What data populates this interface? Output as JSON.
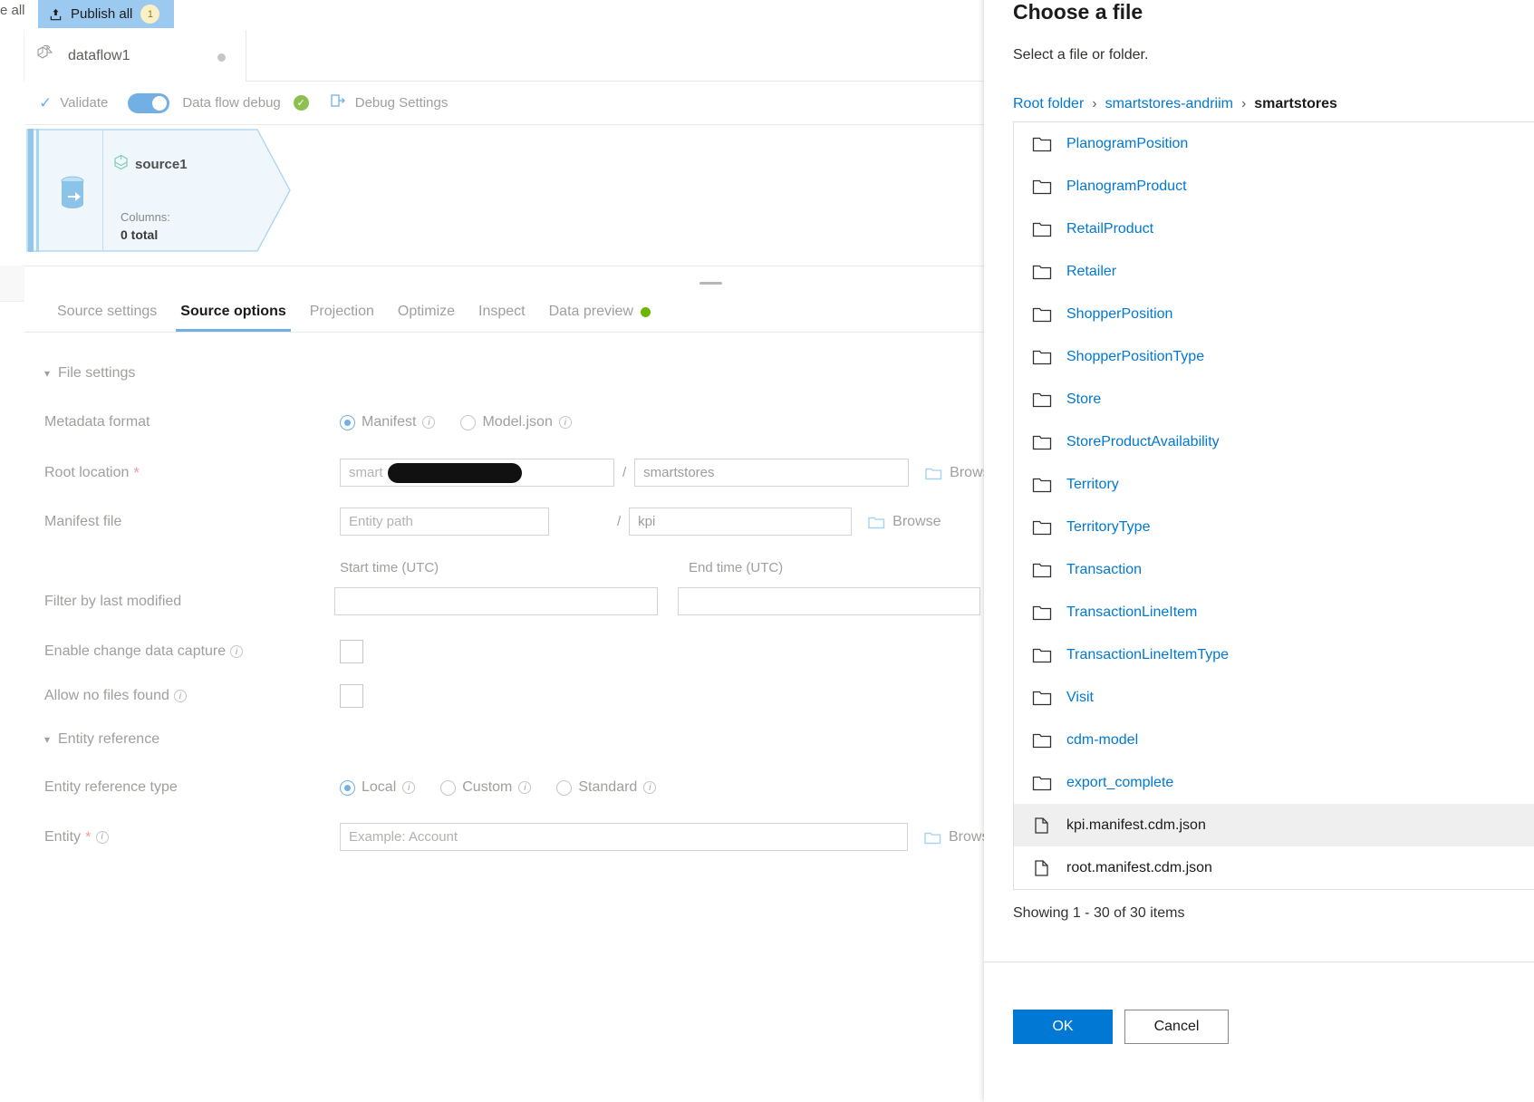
{
  "colors": {
    "accent": "#0078d4",
    "link": "#0078d4",
    "publish_bar": "#9cc9ef",
    "toggle_on": "#71afe5",
    "status_green": "#6bb700",
    "debug_ok": "#8cc152",
    "required_star": "#e8a0a0",
    "node_fill": "#eff6fc",
    "node_stroke": "#a7d3f0"
  },
  "topbar": {
    "left_partial_label": "e all",
    "publish_all_label": "Publish all",
    "publish_all_badge": "1",
    "publish_icon": "upload-icon"
  },
  "dataflow_tab": {
    "name": "dataflow1",
    "icon": "dataflow-icon",
    "modified_dot": "unsaved-dot"
  },
  "toolbar": {
    "validate_label": "Validate",
    "validate_icon": "checkmark-icon",
    "debug_toggle_label": "Data flow debug",
    "debug_toggle_on": true,
    "debug_status_icon": "check-circle-icon",
    "debug_settings_label": "Debug Settings",
    "debug_settings_icon": "debug-settings-icon"
  },
  "canvas": {
    "node": {
      "title": "source1",
      "title_icon": "source-database-icon",
      "side_icon": "source-stream-icon",
      "columns_label": "Columns:",
      "columns_value": "0 total"
    },
    "add_icon": "plus-icon"
  },
  "tabs": [
    {
      "label": "Source settings",
      "active": false,
      "name": "tab-source-settings"
    },
    {
      "label": "Source options",
      "active": true,
      "name": "tab-source-options"
    },
    {
      "label": "Projection",
      "active": false,
      "name": "tab-projection"
    },
    {
      "label": "Optimize",
      "active": false,
      "name": "tab-optimize"
    },
    {
      "label": "Inspect",
      "active": false,
      "name": "tab-inspect"
    },
    {
      "label": "Data preview",
      "active": false,
      "name": "tab-data-preview",
      "status_dot": true
    }
  ],
  "form": {
    "file_settings_header": "File settings",
    "metadata_format": {
      "label": "Metadata format",
      "options": [
        {
          "label": "Manifest",
          "selected": true
        },
        {
          "label": "Model.json",
          "selected": false
        }
      ]
    },
    "root_location": {
      "label": "Root location",
      "required": true,
      "container_value": "smart",
      "container_redacted": true,
      "separator": "/",
      "folder_value": "smartstores",
      "browse_label": "Browse"
    },
    "manifest_file": {
      "label": "Manifest file",
      "entity_placeholder": "Entity path",
      "separator": "/",
      "manifest_value": "kpi",
      "browse_label": "Browse"
    },
    "filter_by_last_modified": {
      "label": "Filter by last modified",
      "start_col_header": "Start time (UTC)",
      "end_col_header": "End time (UTC)",
      "start_value": "",
      "end_value": ""
    },
    "enable_change_data_capture": {
      "label": "Enable change data capture",
      "checked": false
    },
    "allow_no_files_found": {
      "label": "Allow no files found",
      "checked": false
    },
    "entity_reference_header": "Entity reference",
    "entity_reference_type": {
      "label": "Entity reference type",
      "options": [
        {
          "label": "Local",
          "selected": true
        },
        {
          "label": "Custom",
          "selected": false
        },
        {
          "label": "Standard",
          "selected": false
        }
      ]
    },
    "entity": {
      "label": "Entity",
      "required": true,
      "placeholder": "Example: Account",
      "browse_label": "Browse"
    }
  },
  "dialog": {
    "title": "Choose a file",
    "subtitle": "Select a file or folder.",
    "breadcrumb": [
      {
        "label": "Root folder",
        "current": false
      },
      {
        "label": "smartstores-andriim",
        "current": false
      },
      {
        "label": "smartstores",
        "current": true
      }
    ],
    "breadcrumb_separator": "›",
    "items": [
      {
        "name": "PlanogramPosition",
        "type": "folder",
        "selected": false
      },
      {
        "name": "PlanogramProduct",
        "type": "folder",
        "selected": false
      },
      {
        "name": "RetailProduct",
        "type": "folder",
        "selected": false
      },
      {
        "name": "Retailer",
        "type": "folder",
        "selected": false
      },
      {
        "name": "ShopperPosition",
        "type": "folder",
        "selected": false
      },
      {
        "name": "ShopperPositionType",
        "type": "folder",
        "selected": false
      },
      {
        "name": "Store",
        "type": "folder",
        "selected": false
      },
      {
        "name": "StoreProductAvailability",
        "type": "folder",
        "selected": false
      },
      {
        "name": "Territory",
        "type": "folder",
        "selected": false
      },
      {
        "name": "TerritoryType",
        "type": "folder",
        "selected": false
      },
      {
        "name": "Transaction",
        "type": "folder",
        "selected": false
      },
      {
        "name": "TransactionLineItem",
        "type": "folder",
        "selected": false
      },
      {
        "name": "TransactionLineItemType",
        "type": "folder",
        "selected": false
      },
      {
        "name": "Visit",
        "type": "folder",
        "selected": false
      },
      {
        "name": "cdm-model",
        "type": "folder",
        "selected": false
      },
      {
        "name": "export_complete",
        "type": "folder",
        "selected": false
      },
      {
        "name": "kpi.manifest.cdm.json",
        "type": "file",
        "selected": true
      },
      {
        "name": "root.manifest.cdm.json",
        "type": "file",
        "selected": false
      }
    ],
    "showing_text": "Showing 1 - 30 of 30 items",
    "ok_label": "OK",
    "cancel_label": "Cancel"
  }
}
